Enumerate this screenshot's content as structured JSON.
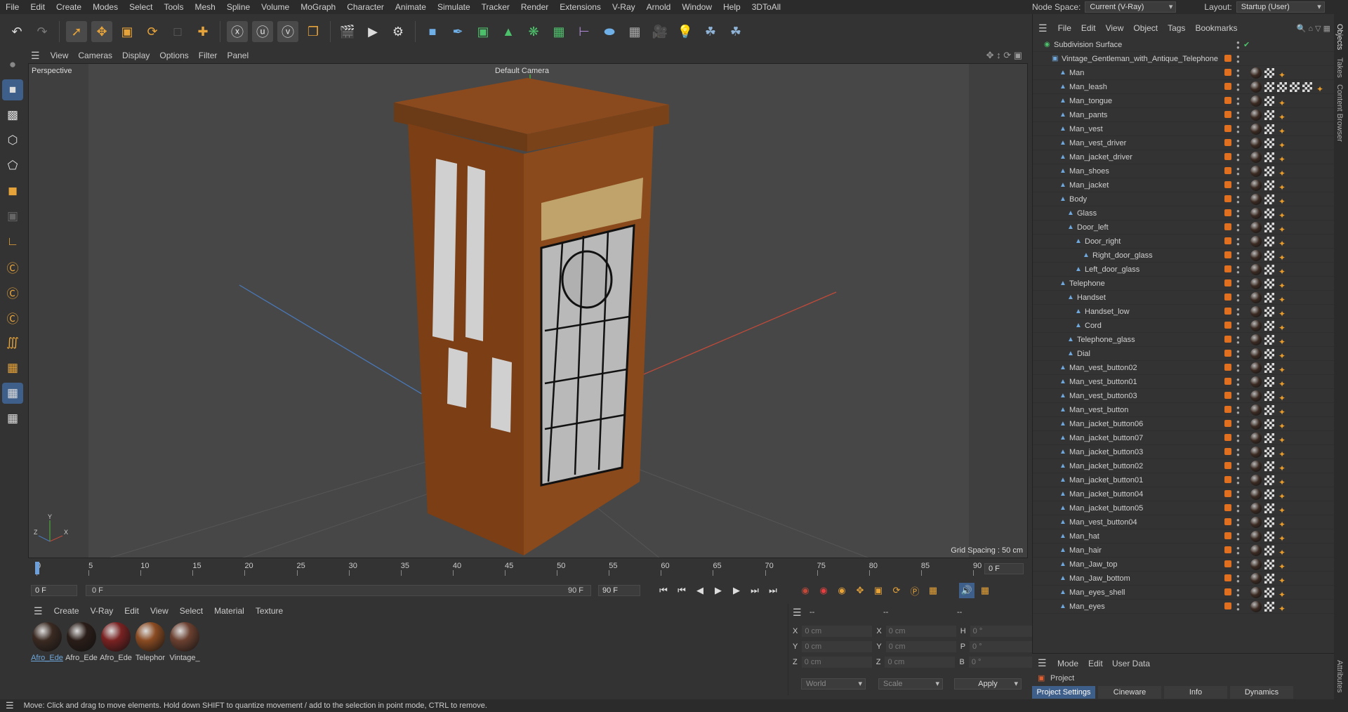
{
  "menubar": {
    "items": [
      "File",
      "Edit",
      "Create",
      "Modes",
      "Select",
      "Tools",
      "Mesh",
      "Spline",
      "Volume",
      "MoGraph",
      "Character",
      "Animate",
      "Simulate",
      "Tracker",
      "Render",
      "Extensions",
      "V-Ray",
      "Arnold",
      "Window",
      "Help",
      "3DToAll"
    ]
  },
  "topright": {
    "node_space_label": "Node Space:",
    "node_space_value": "Current (V-Ray)",
    "layout_label": "Layout:",
    "layout_value": "Startup (User)"
  },
  "viewport": {
    "menu": [
      "View",
      "Cameras",
      "Display",
      "Options",
      "Filter",
      "Panel"
    ],
    "view_name": "Perspective",
    "camera": "Default Camera",
    "grid_spacing": "Grid Spacing : 50 cm"
  },
  "timeline": {
    "ticks": [
      "0",
      "5",
      "10",
      "15",
      "20",
      "25",
      "30",
      "35",
      "40",
      "45",
      "50",
      "55",
      "60",
      "65",
      "70",
      "75",
      "80",
      "85",
      "90"
    ],
    "current_frame_right": "0 F",
    "start_frame": "0 F",
    "range_start": "0 F",
    "range_end": "90 F",
    "end_frame": "90 F"
  },
  "materials": {
    "menu": [
      "Create",
      "V-Ray",
      "Edit",
      "View",
      "Select",
      "Material",
      "Texture"
    ],
    "items": [
      {
        "label": "Afro_Ede",
        "color": "#3a2a22"
      },
      {
        "label": "Afro_Ede",
        "color": "#2a1d18"
      },
      {
        "label": "Afro_Ede",
        "color": "#7a2222"
      },
      {
        "label": "Telephor",
        "color": "#8a4b22"
      },
      {
        "label": "Vintage_",
        "color": "#6b4030"
      }
    ]
  },
  "coords": {
    "header": [
      "--",
      "--",
      "--"
    ],
    "rows": [
      {
        "a": "X",
        "av": "0 cm",
        "b": "X",
        "bv": "0 cm",
        "c": "H",
        "cv": "0 °"
      },
      {
        "a": "Y",
        "av": "0 cm",
        "b": "Y",
        "bv": "0 cm",
        "c": "P",
        "cv": "0 °"
      },
      {
        "a": "Z",
        "av": "0 cm",
        "b": "Z",
        "bv": "0 cm",
        "c": "B",
        "cv": "0 °"
      }
    ],
    "world": "World",
    "scale": "Scale",
    "apply": "Apply"
  },
  "objects": {
    "menu": [
      "File",
      "Edit",
      "View",
      "Object",
      "Tags",
      "Bookmarks"
    ],
    "tree": [
      {
        "name": "Subdivision Surface",
        "depth": 0
      },
      {
        "name": "Vintage_Gentleman_with_Antique_Telephone",
        "depth": 1
      },
      {
        "name": "Man",
        "depth": 2
      },
      {
        "name": "Man_leash",
        "depth": 2
      },
      {
        "name": "Man_tongue",
        "depth": 2
      },
      {
        "name": "Man_pants",
        "depth": 2
      },
      {
        "name": "Man_vest",
        "depth": 2
      },
      {
        "name": "Man_vest_driver",
        "depth": 2
      },
      {
        "name": "Man_jacket_driver",
        "depth": 2
      },
      {
        "name": "Man_shoes",
        "depth": 2
      },
      {
        "name": "Man_jacket",
        "depth": 2
      },
      {
        "name": "Body",
        "depth": 2
      },
      {
        "name": "Glass",
        "depth": 3
      },
      {
        "name": "Door_left",
        "depth": 3
      },
      {
        "name": "Door_right",
        "depth": 4
      },
      {
        "name": "Right_door_glass",
        "depth": 5
      },
      {
        "name": "Left_door_glass",
        "depth": 4
      },
      {
        "name": "Telephone",
        "depth": 2
      },
      {
        "name": "Handset",
        "depth": 3
      },
      {
        "name": "Handset_low",
        "depth": 4
      },
      {
        "name": "Cord",
        "depth": 4
      },
      {
        "name": "Telephone_glass",
        "depth": 3
      },
      {
        "name": "Dial",
        "depth": 3
      },
      {
        "name": "Man_vest_button02",
        "depth": 2
      },
      {
        "name": "Man_vest_button01",
        "depth": 2
      },
      {
        "name": "Man_vest_button03",
        "depth": 2
      },
      {
        "name": "Man_vest_button",
        "depth": 2
      },
      {
        "name": "Man_jacket_button06",
        "depth": 2
      },
      {
        "name": "Man_jacket_button07",
        "depth": 2
      },
      {
        "name": "Man_jacket_button03",
        "depth": 2
      },
      {
        "name": "Man_jacket_button02",
        "depth": 2
      },
      {
        "name": "Man_jacket_button01",
        "depth": 2
      },
      {
        "name": "Man_jacket_button04",
        "depth": 2
      },
      {
        "name": "Man_jacket_button05",
        "depth": 2
      },
      {
        "name": "Man_vest_button04",
        "depth": 2
      },
      {
        "name": "Man_hat",
        "depth": 2
      },
      {
        "name": "Man_hair",
        "depth": 2
      },
      {
        "name": "Man_Jaw_top",
        "depth": 2
      },
      {
        "name": "Man_Jaw_bottom",
        "depth": 2
      },
      {
        "name": "Man_eyes_shell",
        "depth": 2
      },
      {
        "name": "Man_eyes",
        "depth": 2
      }
    ]
  },
  "vtabs": [
    "Objects",
    "Takes",
    "Content Browser",
    "Attributes"
  ],
  "attributes": {
    "menu": [
      "Mode",
      "Edit",
      "User Data"
    ],
    "project": "Project",
    "tabs": [
      "Project Settings",
      "Cineware",
      "Info",
      "Dynamics"
    ]
  },
  "status": "Move: Click and drag to move elements. Hold down SHIFT to quantize movement / add to the selection in point mode, CTRL to remove."
}
